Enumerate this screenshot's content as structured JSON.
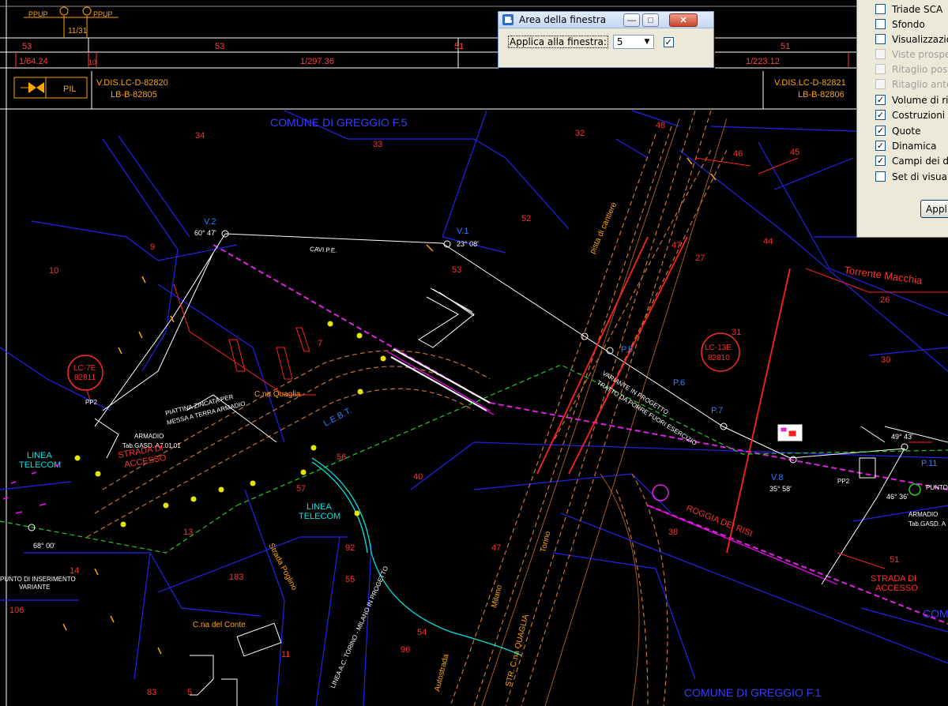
{
  "title_block": {
    "header_left": "PPUP",
    "header_left2": "PPUP",
    "sheet_ref": "11/31",
    "kilo_values": [
      "53",
      "53",
      "51",
      "51"
    ],
    "scale_left": "1/64.24",
    "scale_mid_small": "10",
    "scale_mid": "1/297.36",
    "scale_right": "1/223.12",
    "legend_label": "PIL",
    "ref_left_line1": "V.DIS.LC-D-82820",
    "ref_left_line2": "LB-B-82805",
    "ref_right_line1": "V.DIS.LC-D-82821",
    "ref_right_line2": "LB-B-82806"
  },
  "drawing": {
    "comune_top": "COMUNE DI GREGGIO F.5",
    "comune_bottom": "COMUNE DI GREGGIO F.1",
    "comune_right": "COM",
    "torrente": "Torrente Macchia",
    "parcels": [
      "34",
      "33",
      "32",
      "48",
      "46",
      "45",
      "9",
      "10",
      "52",
      "47",
      "27",
      "44",
      "26",
      "53",
      "7",
      "31",
      "30",
      "40",
      "56",
      "57",
      "13",
      "14",
      "92",
      "55",
      "47",
      "51",
      "106",
      "183",
      "11",
      "96",
      "54",
      "38",
      "5",
      "83"
    ],
    "vertices": {
      "v2": "V.2",
      "v2_angle": "60° 47'",
      "v1": "V.1",
      "v1_angle": "23° 08'",
      "v8": "V.8",
      "v8_angle": "35° 58'",
      "angle_right": "49° 43'",
      "angle_right2": "46° 36'",
      "angle_left_bottom": "68° 00'"
    },
    "points": {
      "p5": "P.5",
      "p6": "P.6",
      "p7": "P.7",
      "p11": "P.11"
    },
    "stations": {
      "lc7e_1": "LC-7E",
      "lc7e_2": "82811",
      "lc13e_1": "LC-13E",
      "lc13e_2": "82810"
    },
    "labels": {
      "cavi_pe": "CAVI P.E.",
      "pista_cantiere": "pista di cantiere",
      "variante": "VARIANTE IN PROGETTO",
      "tratto": "TRATTO DA PORRE FUORI ESERCIZIO",
      "cna_quaglia": "C.na Quaglia",
      "cna_conte": "C.na del Conte",
      "linea_telecom_1a": "LINEA",
      "linea_telecom_1b": "TELECOM",
      "linea_telecom_2a": "LINEA",
      "linea_telecom_2b": "TELECOM",
      "strada_accesso_1a": "STRADA DI",
      "strada_accesso_1b": "ACCESSO",
      "strada_accesso_2a": "STRADA DI",
      "strada_accesso_2b": "ACCESSO",
      "piattina_1": "PIATTINA ZINCATA PER",
      "piattina_2": "MESSA A TERRA ARMADIO",
      "armadio_1": "ARMADIO",
      "armadio_1b": "Tab.GASD. A7.01.01",
      "armadio_2": "ARMADIO",
      "armadio_2b": "Tab.GASD. A",
      "pp2_1": "PP2",
      "pp2_2": "PP2",
      "leb": "L.E.B.T.",
      "roggia": "ROGGIA DEI RISI",
      "strada_poglino": "Strada Poglino",
      "linea_torino": "LINEA A.C. TORINO - MILANO IN PROGETTO",
      "autostrada": "Autostrada",
      "milano": "Milano",
      "torino": "Torino",
      "str_cna_quaglia": "STR. C.na QUAGLIA",
      "punto_ins_1": "PUNTO DI INSERIMENTO",
      "punto_ins_2": "VARIANTE",
      "punto_right": "PUNTO"
    }
  },
  "dialog": {
    "title": "Area della finestra",
    "apply_label": "Applica alla finestra:",
    "apply_value": "5",
    "checked": true,
    "minimize_icon": "minimize-icon",
    "maximize_icon": "maximize-icon",
    "close_icon": "close-icon"
  },
  "view_panel": {
    "items": [
      {
        "label": "Triade SCA",
        "checked": false,
        "enabled": true
      },
      {
        "label": "Sfondo",
        "checked": false,
        "enabled": true
      },
      {
        "label": "Visualizzazion",
        "checked": false,
        "enabled": true
      },
      {
        "label": "Viste prospett",
        "checked": false,
        "enabled": false
      },
      {
        "label": "Ritaglio poste",
        "checked": false,
        "enabled": false
      },
      {
        "label": "Ritaglio anteri",
        "checked": false,
        "enabled": false
      },
      {
        "label": "Volume di rita",
        "checked": true,
        "enabled": true
      },
      {
        "label": "Costruzioni",
        "checked": true,
        "enabled": true
      },
      {
        "label": "Quote",
        "checked": true,
        "enabled": true
      },
      {
        "label": "Dinamica",
        "checked": true,
        "enabled": true
      },
      {
        "label": "Campi dei dat",
        "checked": true,
        "enabled": true
      },
      {
        "label": "Set di visualiz",
        "checked": false,
        "enabled": true
      }
    ],
    "apply_button": "Appl"
  }
}
